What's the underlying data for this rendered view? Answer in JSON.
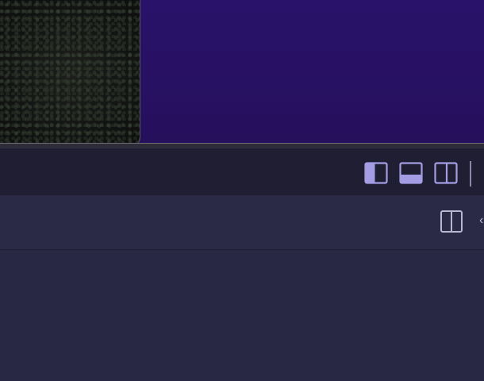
{
  "colors": {
    "accent": "#9f95e8",
    "icon_stroke": "#a49de3",
    "toolbar_bg": "#1f1e33",
    "panel_bg": "#2a2946",
    "content_bg": "#282744",
    "wallpaper": "#27115e"
  },
  "preview": {
    "thumbnail_icon": "image-thumbnail",
    "background_icon": "purple-wallpaper"
  },
  "toolbar": {
    "buttons": [
      {
        "icon": "sidebar-left-icon",
        "state": "active"
      },
      {
        "icon": "panel-bottom-icon",
        "state": "active"
      },
      {
        "icon": "sidebar-right-icon",
        "state": "inactive"
      }
    ]
  },
  "panel": {
    "split_icon": "split-view-icon"
  }
}
